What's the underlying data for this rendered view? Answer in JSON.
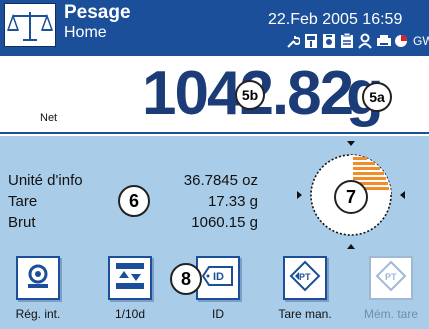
{
  "header": {
    "title": "Pesage",
    "subtitle": "Home",
    "datetime": "22.Feb 2005  16:59",
    "status_icons": [
      "wrench-icon",
      "level-icon",
      "calibration-icon",
      "clipboard-icon",
      "user-icon",
      "printer-icon",
      "tolerance-icon"
    ],
    "gwp": "GWP"
  },
  "weight": {
    "mode_label": "Net",
    "value": "1042.82",
    "unit": "g"
  },
  "info": {
    "rows": [
      {
        "label": "Unité d'info",
        "value": "36.7845 oz"
      },
      {
        "label": "Tare",
        "value": "17.33 g"
      },
      {
        "label": "Brut",
        "value": "1060.15 g"
      }
    ]
  },
  "softkeys": [
    {
      "label": "Rég. int.",
      "icon": "internal-adjust-icon",
      "enabled": true
    },
    {
      "label": "1/10d",
      "icon": "resolution-icon",
      "enabled": true
    },
    {
      "label": "ID",
      "icon": "id-tag-icon",
      "enabled": true
    },
    {
      "label": "Tare man.",
      "icon": "preset-tare-icon",
      "enabled": true
    },
    {
      "label": "Mém. tare",
      "icon": "tare-memory-icon",
      "enabled": false
    }
  ],
  "callouts": {
    "c5b": "5b",
    "c5a": "5a",
    "c6": "6",
    "c7": "7",
    "c8": "8"
  },
  "colors": {
    "header_bg": "#1c4f99",
    "info_bg": "#a9cde9",
    "weight_text": "#1c3c78",
    "gauge_fill": "#f28c28"
  }
}
